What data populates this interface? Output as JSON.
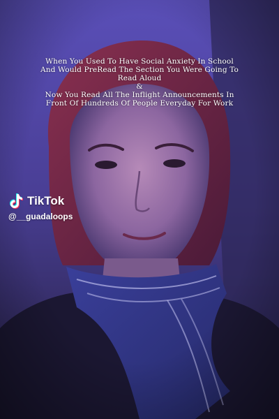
{
  "caption": {
    "line1": "When You Used To Have Social Anxiety In School",
    "line2": "And Would PreRead The Section You Were Going To",
    "line3": "Read Aloud",
    "line4": "&",
    "line5": "Now You Read All The Inflight Announcements In",
    "line6": "Front Of Hundreds Of People Everyday For Work"
  },
  "watermark": {
    "brand": "TikTok",
    "handle": "@__guadaloops",
    "icon": "tiktok-note-icon"
  },
  "colors": {
    "background": "#2a2450",
    "hair": "#7a2a48",
    "scarf": "#3a3f9a",
    "text": "#ffffff"
  }
}
